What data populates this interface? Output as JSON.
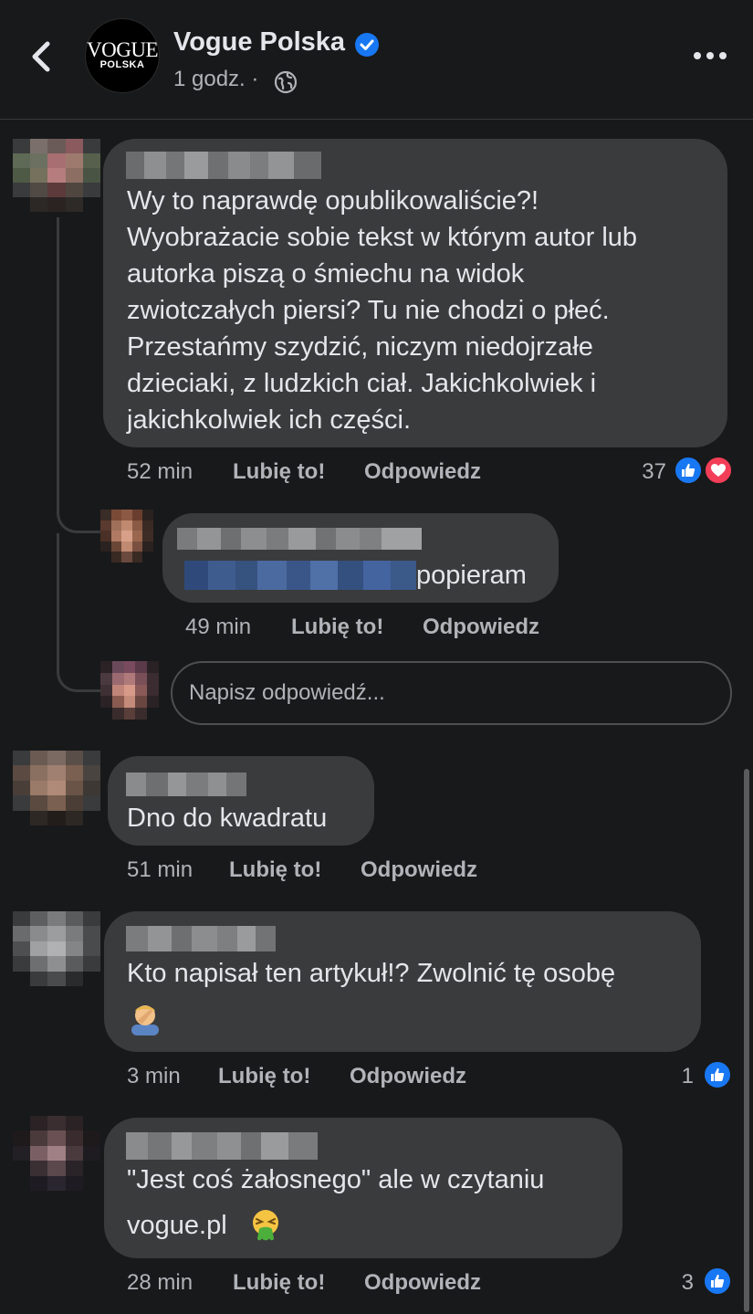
{
  "header": {
    "page_name": "Vogue Polska",
    "logo_main": "VOGUE",
    "logo_sub": "POLSKA",
    "time": "1 godz. ·",
    "icons": [
      "back-icon",
      "verified-badge-icon",
      "globe-icon",
      "more-icon"
    ]
  },
  "comments": [
    {
      "lines": [
        "Wy to naprawdę opublikowaliście?!",
        "Wyobrażacie sobie tekst w którym autor lub",
        "autorka piszą o śmiechu na widok",
        "zwiotczałych piersi? Tu nie chodzi o płeć.",
        "Przestańmy szydzić, niczym niedojrzałe",
        "dzieciaki, z ludzkich ciał. Jakichkolwiek i",
        "jakichkolwiek ich części."
      ],
      "time": "52 min",
      "like_label": "Lubię to!",
      "reply_label": "Odpowiedz",
      "reaction_count": "37",
      "reactions": [
        "like",
        "love"
      ]
    },
    {
      "text": "popieram",
      "time": "49 min",
      "like_label": "Lubię to!",
      "reply_label": "Odpowiedz"
    },
    {
      "text": "Dno do kwadratu",
      "time": "51 min",
      "like_label": "Lubię to!",
      "reply_label": "Odpowiedz"
    },
    {
      "text": "Kto napisał ten artykuł!? Zwolnić tę osobę",
      "emoji": "facepalm",
      "time": "3 min",
      "like_label": "Lubię to!",
      "reply_label": "Odpowiedz",
      "reaction_count": "1",
      "reactions": [
        "like"
      ]
    },
    {
      "lines": [
        "\"Jest coś żałosnego\" ale w czytaniu",
        "vogue.pl"
      ],
      "emoji": "vomiting-face",
      "time": "28 min",
      "like_label": "Lubię to!",
      "reply_label": "Odpowiedz",
      "reaction_count": "3",
      "reactions": [
        "like"
      ]
    }
  ],
  "reply_box": {
    "placeholder": "Napisz odpowiedź..."
  },
  "colors": {
    "background": "#18191a",
    "bubble": "#3a3b3c",
    "text": "#e4e6eb",
    "secondary": "#b0b3b8",
    "like": "#1877f2",
    "love": "#f33e58"
  }
}
